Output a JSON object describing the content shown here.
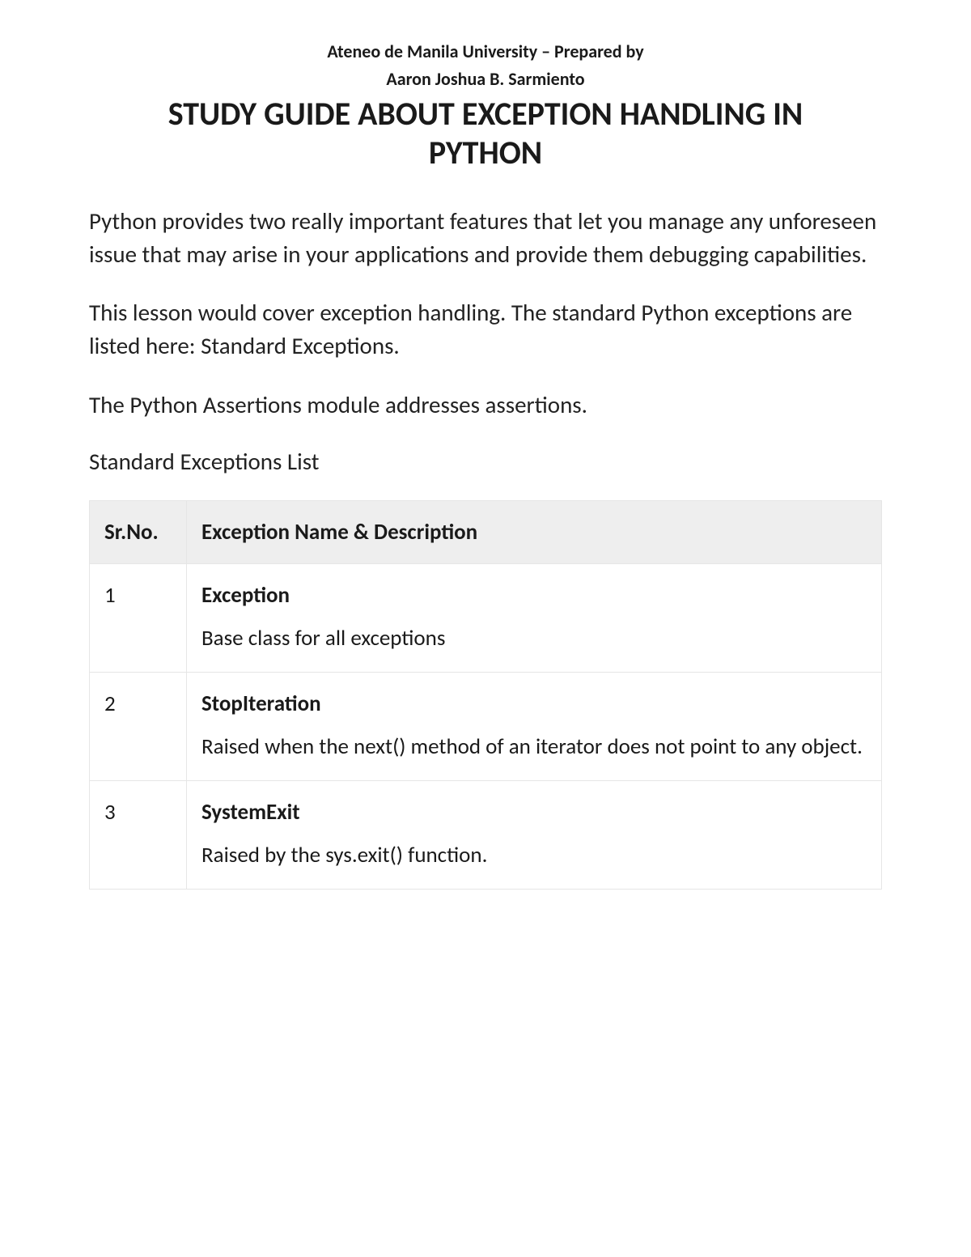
{
  "header": {
    "institution": "Ateneo de Manila University – Prepared by",
    "author": "Aaron Joshua B. Sarmiento"
  },
  "title": "STUDY GUIDE ABOUT EXCEPTION HANDLING IN PYTHON",
  "paragraphs": [
    "Python provides two really important features that let you manage any unforeseen issue that may arise in your applications and provide them debugging capabilities.",
    "This lesson would cover exception handling. The standard Python exceptions are listed here: Standard Exceptions.",
    "The Python Assertions module addresses assertions."
  ],
  "subheading": "Standard Exceptions List",
  "table": {
    "headers": {
      "sr": "Sr.No.",
      "desc": "Exception Name & Description"
    },
    "rows": [
      {
        "sr": "1",
        "name": "Exception",
        "desc": "Base class for all exceptions"
      },
      {
        "sr": "2",
        "name": "StopIteration",
        "desc": "Raised when the next() method of an iterator does not point to any object."
      },
      {
        "sr": "3",
        "name": "SystemExit",
        "desc": "Raised by the sys.exit() function."
      }
    ]
  }
}
